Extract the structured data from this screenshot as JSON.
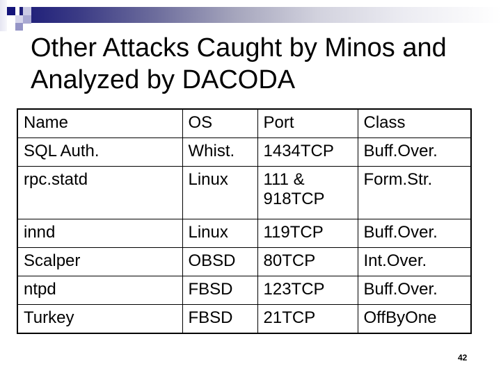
{
  "decoration": {
    "icon": "blue-squares-logo-icon",
    "bar_colors": [
      "#1c1c78",
      "#ffffff"
    ]
  },
  "title": {
    "line1": "Other Attacks Caught by Minos and",
    "line2": "Analyzed by DACODA"
  },
  "table": {
    "headers": [
      "Name",
      "OS",
      "Port",
      "Class"
    ],
    "rows": [
      {
        "name": "SQL Auth.",
        "os": "Whist.",
        "port": [
          "1434TCP"
        ],
        "class": "Buff.Over."
      },
      {
        "name": "rpc.statd",
        "os": "Linux",
        "port": [
          "111 &",
          "918TCP"
        ],
        "class": "Form.Str."
      },
      {
        "name": "innd",
        "os": "Linux",
        "port": [
          "119TCP"
        ],
        "class": "Buff.Over."
      },
      {
        "name": "Scalper",
        "os": "OBSD",
        "port": [
          "80TCP"
        ],
        "class": "Int.Over."
      },
      {
        "name": "ntpd",
        "os": "FBSD",
        "port": [
          "123TCP"
        ],
        "class": "Buff.Over."
      },
      {
        "name": "Turkey",
        "os": "FBSD",
        "port": [
          "21TCP"
        ],
        "class": "OffByOne"
      }
    ]
  },
  "page_number": "42"
}
